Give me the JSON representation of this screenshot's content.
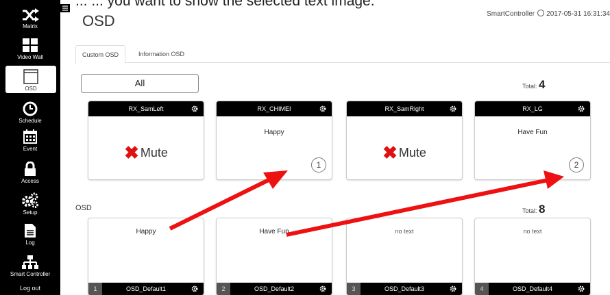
{
  "caption": "... ... you want to show the selected text image.",
  "sidebar": {
    "items": [
      {
        "label": "Matrix",
        "icon": "shuffle-icon"
      },
      {
        "label": "Video Wall",
        "icon": "grid-icon"
      },
      {
        "label": "OSD",
        "icon": "window-icon"
      },
      {
        "label": "Schedule",
        "icon": "clock-icon"
      },
      {
        "label": "Event",
        "icon": "calendar-icon"
      },
      {
        "label": "Access",
        "icon": "lock-icon"
      },
      {
        "label": "Setup",
        "icon": "gears-icon"
      },
      {
        "label": "Log",
        "icon": "document-icon"
      },
      {
        "label": "Smart Controller",
        "icon": "network-icon"
      }
    ],
    "logout": "Log out"
  },
  "header": {
    "title": "OSD",
    "app_name": "SmartController",
    "datetime": "2017-05-31 16:31:34"
  },
  "tabs": [
    {
      "label": "Custom OSD",
      "active": true
    },
    {
      "label": "Information OSD",
      "active": false
    }
  ],
  "filter": {
    "label": "All"
  },
  "receivers": {
    "total_label": "Total:",
    "total": "4",
    "cards": [
      {
        "name": "RX_SamLeft",
        "mute": "Mute"
      },
      {
        "name": "RX_CHIMEI",
        "text": "Happy",
        "osd_number": "1"
      },
      {
        "name": "RX_SamRight",
        "mute": "Mute"
      },
      {
        "name": "RX_LG",
        "text": "Have Fun",
        "osd_number": "2"
      }
    ]
  },
  "osd_section": {
    "label": "OSD",
    "total_label": "Total:",
    "total": "8",
    "cards": [
      {
        "index": "1",
        "name": "OSD_Default1",
        "text": "Happy"
      },
      {
        "index": "2",
        "name": "OSD_Default2",
        "text": "Have Fun"
      },
      {
        "index": "3",
        "name": "OSD_Default3",
        "text": "no text"
      },
      {
        "index": "4",
        "name": "OSD_Default4",
        "text": "no text"
      }
    ]
  },
  "colors": {
    "sidebar_bg": "#000000",
    "card_header_bg": "#000000",
    "mute_x": "#e01010",
    "annotation_arrow": "#ee1111"
  }
}
